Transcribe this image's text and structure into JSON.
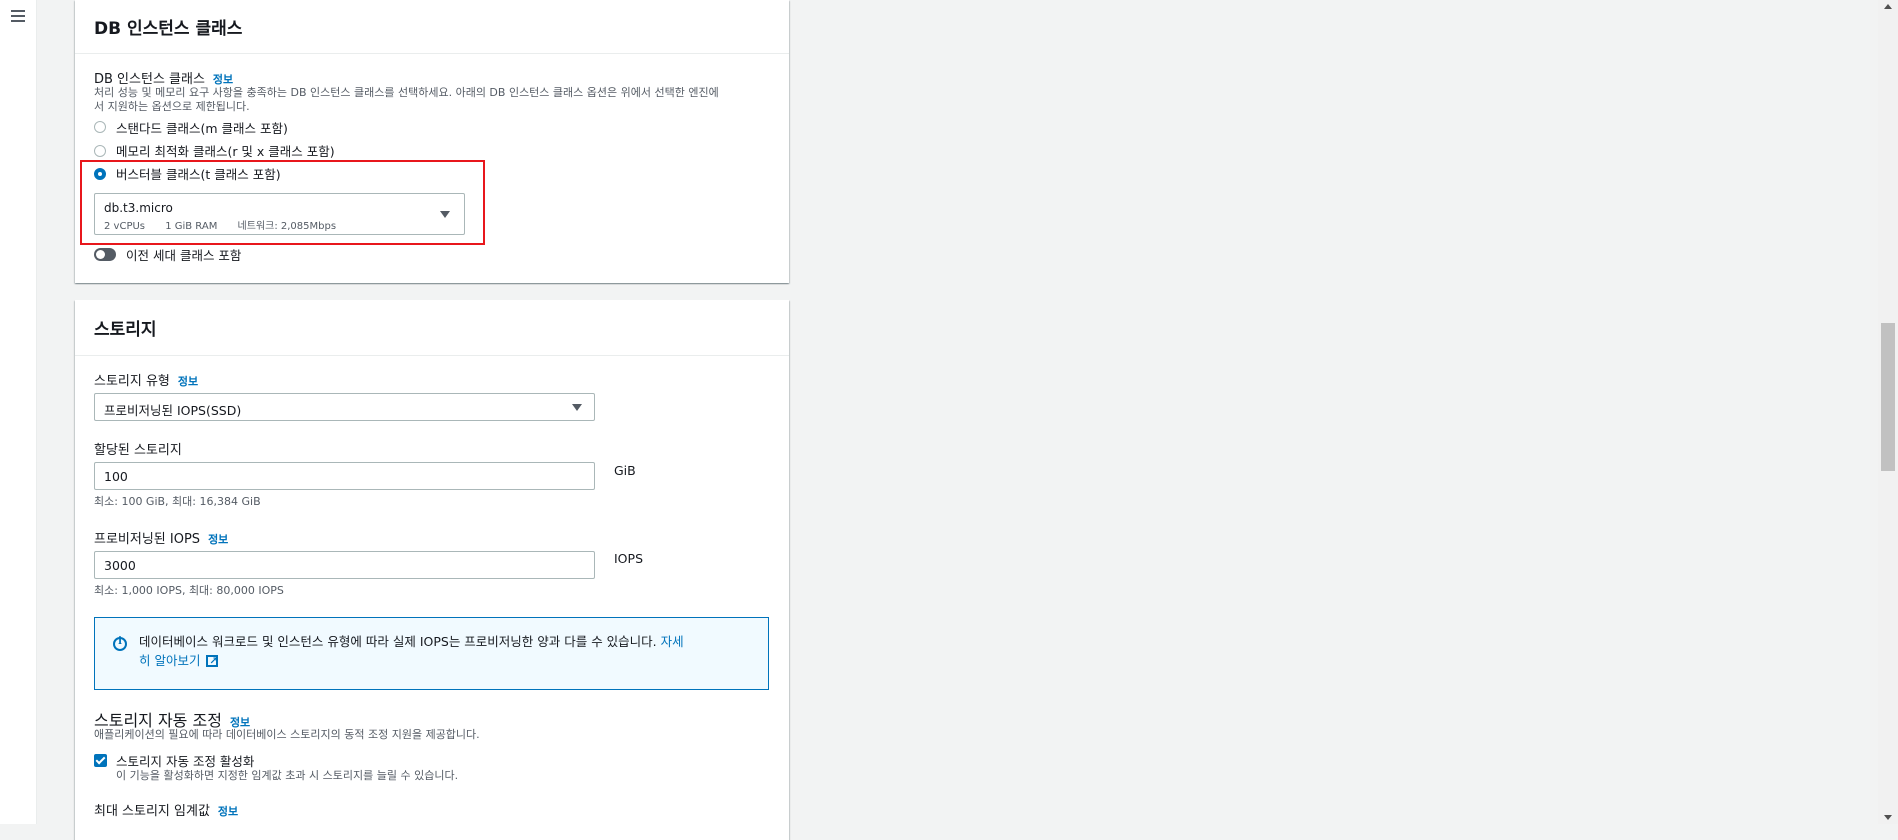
{
  "nav": {
    "menu_icon": "hamburger-menu-icon"
  },
  "instance_panel": {
    "title": "DB 인스턴스 클래스",
    "field_label": "DB 인스턴스 클래스",
    "info": "정보",
    "description_line1": "처리 성능 및 메모리 요구 사항을 충족하는 DB 인스턴스 클래스를 선택하세요. 아래의 DB 인스턴스 클래스 옵션은 위에서 선택한 엔진에",
    "description_line2": "서 지원하는 옵션으로 제한됩니다.",
    "options": [
      {
        "label": "스탠다드 클래스(m 클래스 포함)",
        "selected": false
      },
      {
        "label": "메모리 최적화 클래스(r 및 x 클래스 포함)",
        "selected": false
      },
      {
        "label": "버스터블 클래스(t 클래스 포함)",
        "selected": true
      }
    ],
    "selected_class": {
      "name": "db.t3.micro",
      "vcpu": "2 vCPUs",
      "ram": "1 GiB RAM",
      "network": "네트워크: 2,085Mbps"
    },
    "toggle_label": "이전 세대 클래스 포함",
    "toggle_on": false
  },
  "storage_panel": {
    "title": "스토리지",
    "storage_type_label": "스토리지 유형",
    "info": "정보",
    "storage_type_value": "프로비저닝된 IOPS(SSD)",
    "allocated_label": "할당된 스토리지",
    "allocated_value": "100",
    "allocated_unit": "GiB",
    "allocated_hint": "최소: 100 GiB, 최대: 16,384 GiB",
    "iops_label": "프로비저닝된 IOPS",
    "iops_value": "3000",
    "iops_unit": "IOPS",
    "iops_hint": "최소: 1,000 IOPS, 최대: 80,000 IOPS",
    "alert_text": "데이터베이스 워크로드 및 인스턴스 유형에 따라 실제 IOPS는 프로비저닝한 양과 다를 수 있습니다. ",
    "alert_link_part1": "자세",
    "alert_link_part2": "히 알아보기",
    "autoscale_title": "스토리지 자동 조정",
    "autoscale_desc": "애플리케이션의 필요에 따라 데이터베이스 스토리지의 동적 조정 지원을 제공합니다.",
    "autoscale_checkbox_label": "스토리지 자동 조정 활성화",
    "autoscale_checkbox_desc": "이 기능을 활성화하면 지정한 임계값 초과 시 스토리지를 늘릴 수 있습니다.",
    "autoscale_checked": true,
    "max_threshold_label": "최대 스토리지 임계값"
  },
  "colors": {
    "accent": "#0073bb",
    "highlight_box": "#e8171c"
  }
}
